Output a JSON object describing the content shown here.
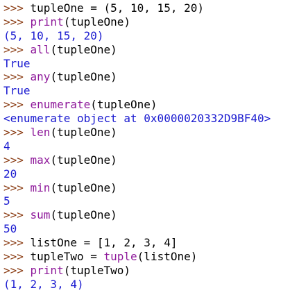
{
  "shell": {
    "prompt": ">>> ",
    "colors": {
      "prompt": "#8a3b12",
      "code": "#000000",
      "builtin": "#8f1a9b",
      "output": "#1a1ad0",
      "background": "#ffffff"
    },
    "lines": [
      {
        "kind": "input",
        "segments": [
          {
            "t": "tupleOne = (5, 10, 15, 20)",
            "c": "code"
          }
        ]
      },
      {
        "kind": "input",
        "segments": [
          {
            "t": "print",
            "c": "builtin"
          },
          {
            "t": "(tupleOne)",
            "c": "code"
          }
        ]
      },
      {
        "kind": "output",
        "text": "(5, 10, 15, 20)"
      },
      {
        "kind": "input",
        "segments": [
          {
            "t": "all",
            "c": "builtin"
          },
          {
            "t": "(tupleOne)",
            "c": "code"
          }
        ]
      },
      {
        "kind": "output",
        "text": "True"
      },
      {
        "kind": "input",
        "segments": [
          {
            "t": "any",
            "c": "builtin"
          },
          {
            "t": "(tupleOne)",
            "c": "code"
          }
        ]
      },
      {
        "kind": "output",
        "text": "True"
      },
      {
        "kind": "input",
        "segments": [
          {
            "t": "enumerate",
            "c": "builtin"
          },
          {
            "t": "(tupleOne)",
            "c": "code"
          }
        ]
      },
      {
        "kind": "output",
        "text": "<enumerate object at 0x0000020332D9BF40>"
      },
      {
        "kind": "input",
        "segments": [
          {
            "t": "len",
            "c": "builtin"
          },
          {
            "t": "(tupleOne)",
            "c": "code"
          }
        ]
      },
      {
        "kind": "output",
        "text": "4"
      },
      {
        "kind": "input",
        "segments": [
          {
            "t": "max",
            "c": "builtin"
          },
          {
            "t": "(tupleOne)",
            "c": "code"
          }
        ]
      },
      {
        "kind": "output",
        "text": "20"
      },
      {
        "kind": "input",
        "segments": [
          {
            "t": "min",
            "c": "builtin"
          },
          {
            "t": "(tupleOne)",
            "c": "code"
          }
        ]
      },
      {
        "kind": "output",
        "text": "5"
      },
      {
        "kind": "input",
        "segments": [
          {
            "t": "sum",
            "c": "builtin"
          },
          {
            "t": "(tupleOne)",
            "c": "code"
          }
        ]
      },
      {
        "kind": "output",
        "text": "50"
      },
      {
        "kind": "input",
        "segments": [
          {
            "t": "listOne = [1, 2, 3, 4]",
            "c": "code"
          }
        ]
      },
      {
        "kind": "input",
        "segments": [
          {
            "t": "tupleTwo = ",
            "c": "code"
          },
          {
            "t": "tuple",
            "c": "builtin"
          },
          {
            "t": "(listOne)",
            "c": "code"
          }
        ]
      },
      {
        "kind": "input",
        "segments": [
          {
            "t": "print",
            "c": "builtin"
          },
          {
            "t": "(tupleTwo)",
            "c": "code"
          }
        ]
      },
      {
        "kind": "output",
        "text": "(1, 2, 3, 4)"
      }
    ]
  }
}
